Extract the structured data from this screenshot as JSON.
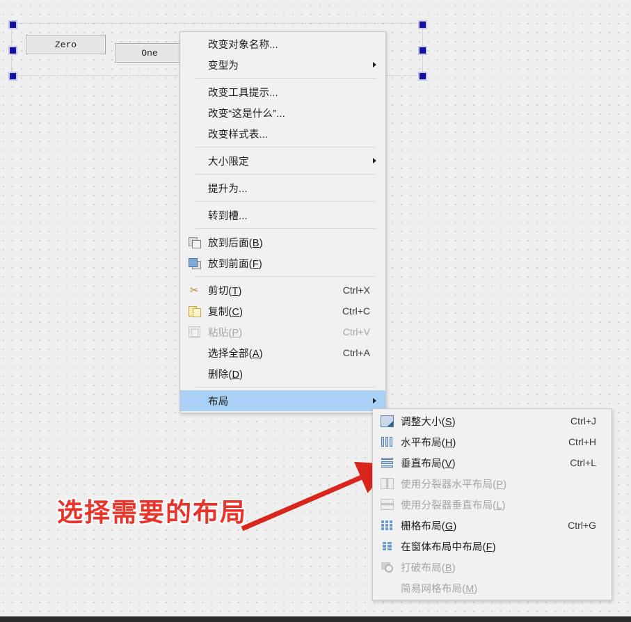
{
  "canvas": {
    "widgets": [
      {
        "name": "button-zero",
        "label": "Zero"
      },
      {
        "name": "button-one",
        "label": "One"
      },
      {
        "name": "button-two",
        "label": ""
      }
    ]
  },
  "context_menu": {
    "items": [
      {
        "label": "改变对象名称...",
        "shortcut": "",
        "icon": "",
        "submenu": false,
        "disabled": false,
        "highlighted": false
      },
      {
        "label": "变型为",
        "shortcut": "",
        "icon": "",
        "submenu": true,
        "disabled": false,
        "highlighted": false
      },
      {
        "separator": true
      },
      {
        "label": "改变工具提示...",
        "shortcut": "",
        "icon": "",
        "submenu": false,
        "disabled": false,
        "highlighted": false
      },
      {
        "label": "改变“这是什么”...",
        "shortcut": "",
        "icon": "",
        "submenu": false,
        "disabled": false,
        "highlighted": false
      },
      {
        "label": "改变样式表...",
        "shortcut": "",
        "icon": "",
        "submenu": false,
        "disabled": false,
        "highlighted": false
      },
      {
        "separator": true
      },
      {
        "label": "大小限定",
        "shortcut": "",
        "icon": "",
        "submenu": true,
        "disabled": false,
        "highlighted": false
      },
      {
        "separator": true
      },
      {
        "label": "提升为...",
        "shortcut": "",
        "icon": "",
        "submenu": false,
        "disabled": false,
        "highlighted": false
      },
      {
        "separator": true
      },
      {
        "label": "转到槽...",
        "shortcut": "",
        "icon": "",
        "submenu": false,
        "disabled": false,
        "highlighted": false
      },
      {
        "separator": true
      },
      {
        "label": "放到后面(B)",
        "mnemonic": "B",
        "shortcut": "",
        "icon": "send-to-back-icon",
        "submenu": false,
        "disabled": false,
        "highlighted": false
      },
      {
        "label": "放到前面(F)",
        "mnemonic": "F",
        "shortcut": "",
        "icon": "bring-to-front-icon",
        "submenu": false,
        "disabled": false,
        "highlighted": false
      },
      {
        "separator": true
      },
      {
        "label": "剪切(T)",
        "mnemonic": "T",
        "shortcut": "Ctrl+X",
        "icon": "scissors-icon",
        "submenu": false,
        "disabled": false,
        "highlighted": false
      },
      {
        "label": "复制(C)",
        "mnemonic": "C",
        "shortcut": "Ctrl+C",
        "icon": "copy-icon",
        "submenu": false,
        "disabled": false,
        "highlighted": false
      },
      {
        "label": "粘贴(P)",
        "mnemonic": "P",
        "shortcut": "Ctrl+V",
        "icon": "paste-icon",
        "submenu": false,
        "disabled": true,
        "highlighted": false
      },
      {
        "label": "选择全部(A)",
        "mnemonic": "A",
        "shortcut": "Ctrl+A",
        "icon": "",
        "submenu": false,
        "disabled": false,
        "highlighted": false
      },
      {
        "label": "删除(D)",
        "mnemonic": "D",
        "shortcut": "",
        "icon": "",
        "submenu": false,
        "disabled": false,
        "highlighted": false
      },
      {
        "separator": true
      },
      {
        "label": "布局",
        "shortcut": "",
        "icon": "",
        "submenu": true,
        "disabled": false,
        "highlighted": true
      }
    ]
  },
  "layout_submenu": {
    "items": [
      {
        "label": "调整大小(S)",
        "mnemonic": "S",
        "shortcut": "Ctrl+J",
        "icon": "adjust-size-icon",
        "disabled": false
      },
      {
        "label": "水平布局(H)",
        "mnemonic": "H",
        "shortcut": "Ctrl+H",
        "icon": "horizontal-layout-icon",
        "disabled": false
      },
      {
        "label": "垂直布局(V)",
        "mnemonic": "V",
        "shortcut": "Ctrl+L",
        "icon": "vertical-layout-icon",
        "disabled": false
      },
      {
        "label": "使用分裂器水平布局(P)",
        "mnemonic": "P",
        "shortcut": "",
        "icon": "splitter-horizontal-icon",
        "disabled": true
      },
      {
        "label": "使用分裂器垂直布局(L)",
        "mnemonic": "L",
        "shortcut": "",
        "icon": "splitter-vertical-icon",
        "disabled": true
      },
      {
        "label": "栅格布局(G)",
        "mnemonic": "G",
        "shortcut": "Ctrl+G",
        "icon": "grid-layout-icon",
        "disabled": false
      },
      {
        "label": "在窗体布局中布局(F)",
        "mnemonic": "F",
        "shortcut": "",
        "icon": "form-layout-icon",
        "disabled": false
      },
      {
        "label": "打破布局(B)",
        "mnemonic": "B",
        "shortcut": "",
        "icon": "break-layout-icon",
        "disabled": true
      },
      {
        "label": "简易网格布局(M)",
        "mnemonic": "M",
        "shortcut": "",
        "icon": "",
        "disabled": true
      }
    ]
  },
  "annotation": {
    "text": "选择需要的布局",
    "color": "#e8342a"
  },
  "colors": {
    "menu_background": "#f1f1f1",
    "highlight": "#a8d1f5",
    "canvas": "#efeff0",
    "selection_handle": "#13119e",
    "annotation_red": "#e8342a"
  }
}
